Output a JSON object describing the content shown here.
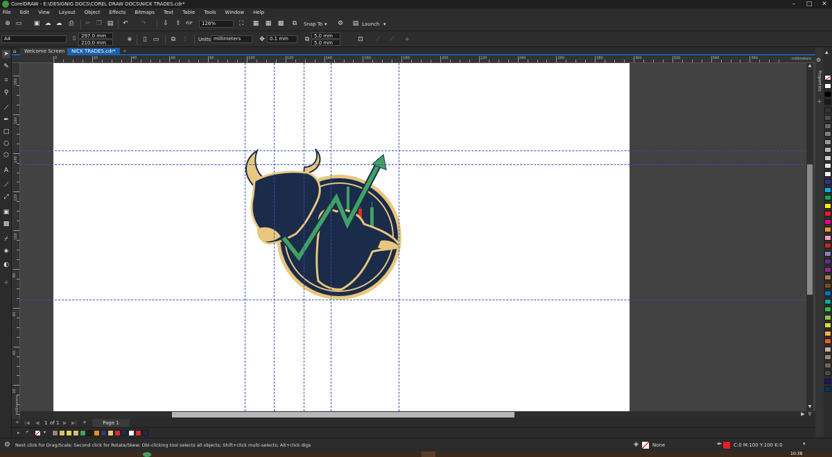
{
  "app": {
    "title": "CorelDRAW - E:\\DESIGNIG DOCS\\COREL DRAW DOCS\\NICK TRADES.cdr*",
    "window_controls": [
      "–",
      "□",
      "✕"
    ]
  },
  "menu": [
    "File",
    "Edit",
    "View",
    "Layout",
    "Object",
    "Effects",
    "Bitmaps",
    "Text",
    "Table",
    "Tools",
    "Window",
    "Help"
  ],
  "toolbar": {
    "zoom": "126%",
    "snap_to": "Snap To",
    "launch": "Launch"
  },
  "property_bar": {
    "page_size": "A4",
    "width": "297.0 mm",
    "height": "210.0 mm",
    "units_label": "Units:",
    "units_value": "millimeters",
    "nudge": "0.1 mm",
    "dup_x": "5.0 mm",
    "dup_y": "5.0 mm"
  },
  "tabs": [
    {
      "label": "Welcome Screen",
      "active": false
    },
    {
      "label": "NICK TRADES.cdr*",
      "active": true
    }
  ],
  "ruler": {
    "unit": "millimeters",
    "h_labels": [
      "0",
      "20",
      "40",
      "60",
      "80",
      "100",
      "120",
      "140",
      "160",
      "180",
      "200",
      "220",
      "240",
      "260",
      "280",
      "300",
      "320",
      "340",
      "360"
    ],
    "v_labels": [
      "180",
      "160",
      "140",
      "120",
      "100",
      "80",
      "60",
      "40",
      "20"
    ]
  },
  "dock": {
    "properties_label": "Properties"
  },
  "page_nav": {
    "current": "1",
    "of_label": "of",
    "total": "1",
    "page_tab": "Page 1"
  },
  "status": {
    "hint": "Next click for Drag/Scale; Second click for Rotate/Skew; Dbl-clicking tool selects all objects; Shift+click multi-selects; Alt+click digs",
    "fill_label": "None",
    "outline_label": "C:0 M:100 Y:100 K:0",
    "time": "10:38"
  },
  "colors": {
    "accent": "#1d5fa8",
    "logo_navy": "#1b2b4a",
    "logo_gold": "#e8c77e",
    "logo_green": "#3fa163",
    "candle_red": "#d8312b",
    "outline_red": "#e81c24"
  },
  "color_palette": [
    "#ffffff",
    "#000000",
    "#1a1a1a",
    "#333333",
    "#4d4d4d",
    "#666666",
    "#808080",
    "#999999",
    "#b3b3b3",
    "#cccccc",
    "#e6e6e6",
    "#f2f2f2",
    "#2e3192",
    "#00aeef",
    "#00a651",
    "#fff200",
    "#ed1c24",
    "#ec008c",
    "#f7941d",
    "#f49ac1",
    "#c1272d",
    "#8781bd",
    "#662d91",
    "#92278f",
    "#a67c52",
    "#754c24",
    "#0072bc",
    "#00a99d",
    "#39b54a",
    "#8dc63f",
    "#d7df23",
    "#fbb040",
    "#f15a24",
    "#c2b59b",
    "#998675",
    "#736357",
    "#534741",
    "#1b1464",
    "#003663"
  ],
  "document_palette": [
    "#9a8478",
    "#d9c27a",
    "#e9d046",
    "#c9c07a",
    "#3fa163",
    "#1a1a1a",
    "#f08a1e",
    "#2c3a7a",
    "#e8c77e",
    "#d8312b",
    "#1b2b4a",
    "#ffffff",
    "#d8312b",
    "#1b2b4a"
  ]
}
